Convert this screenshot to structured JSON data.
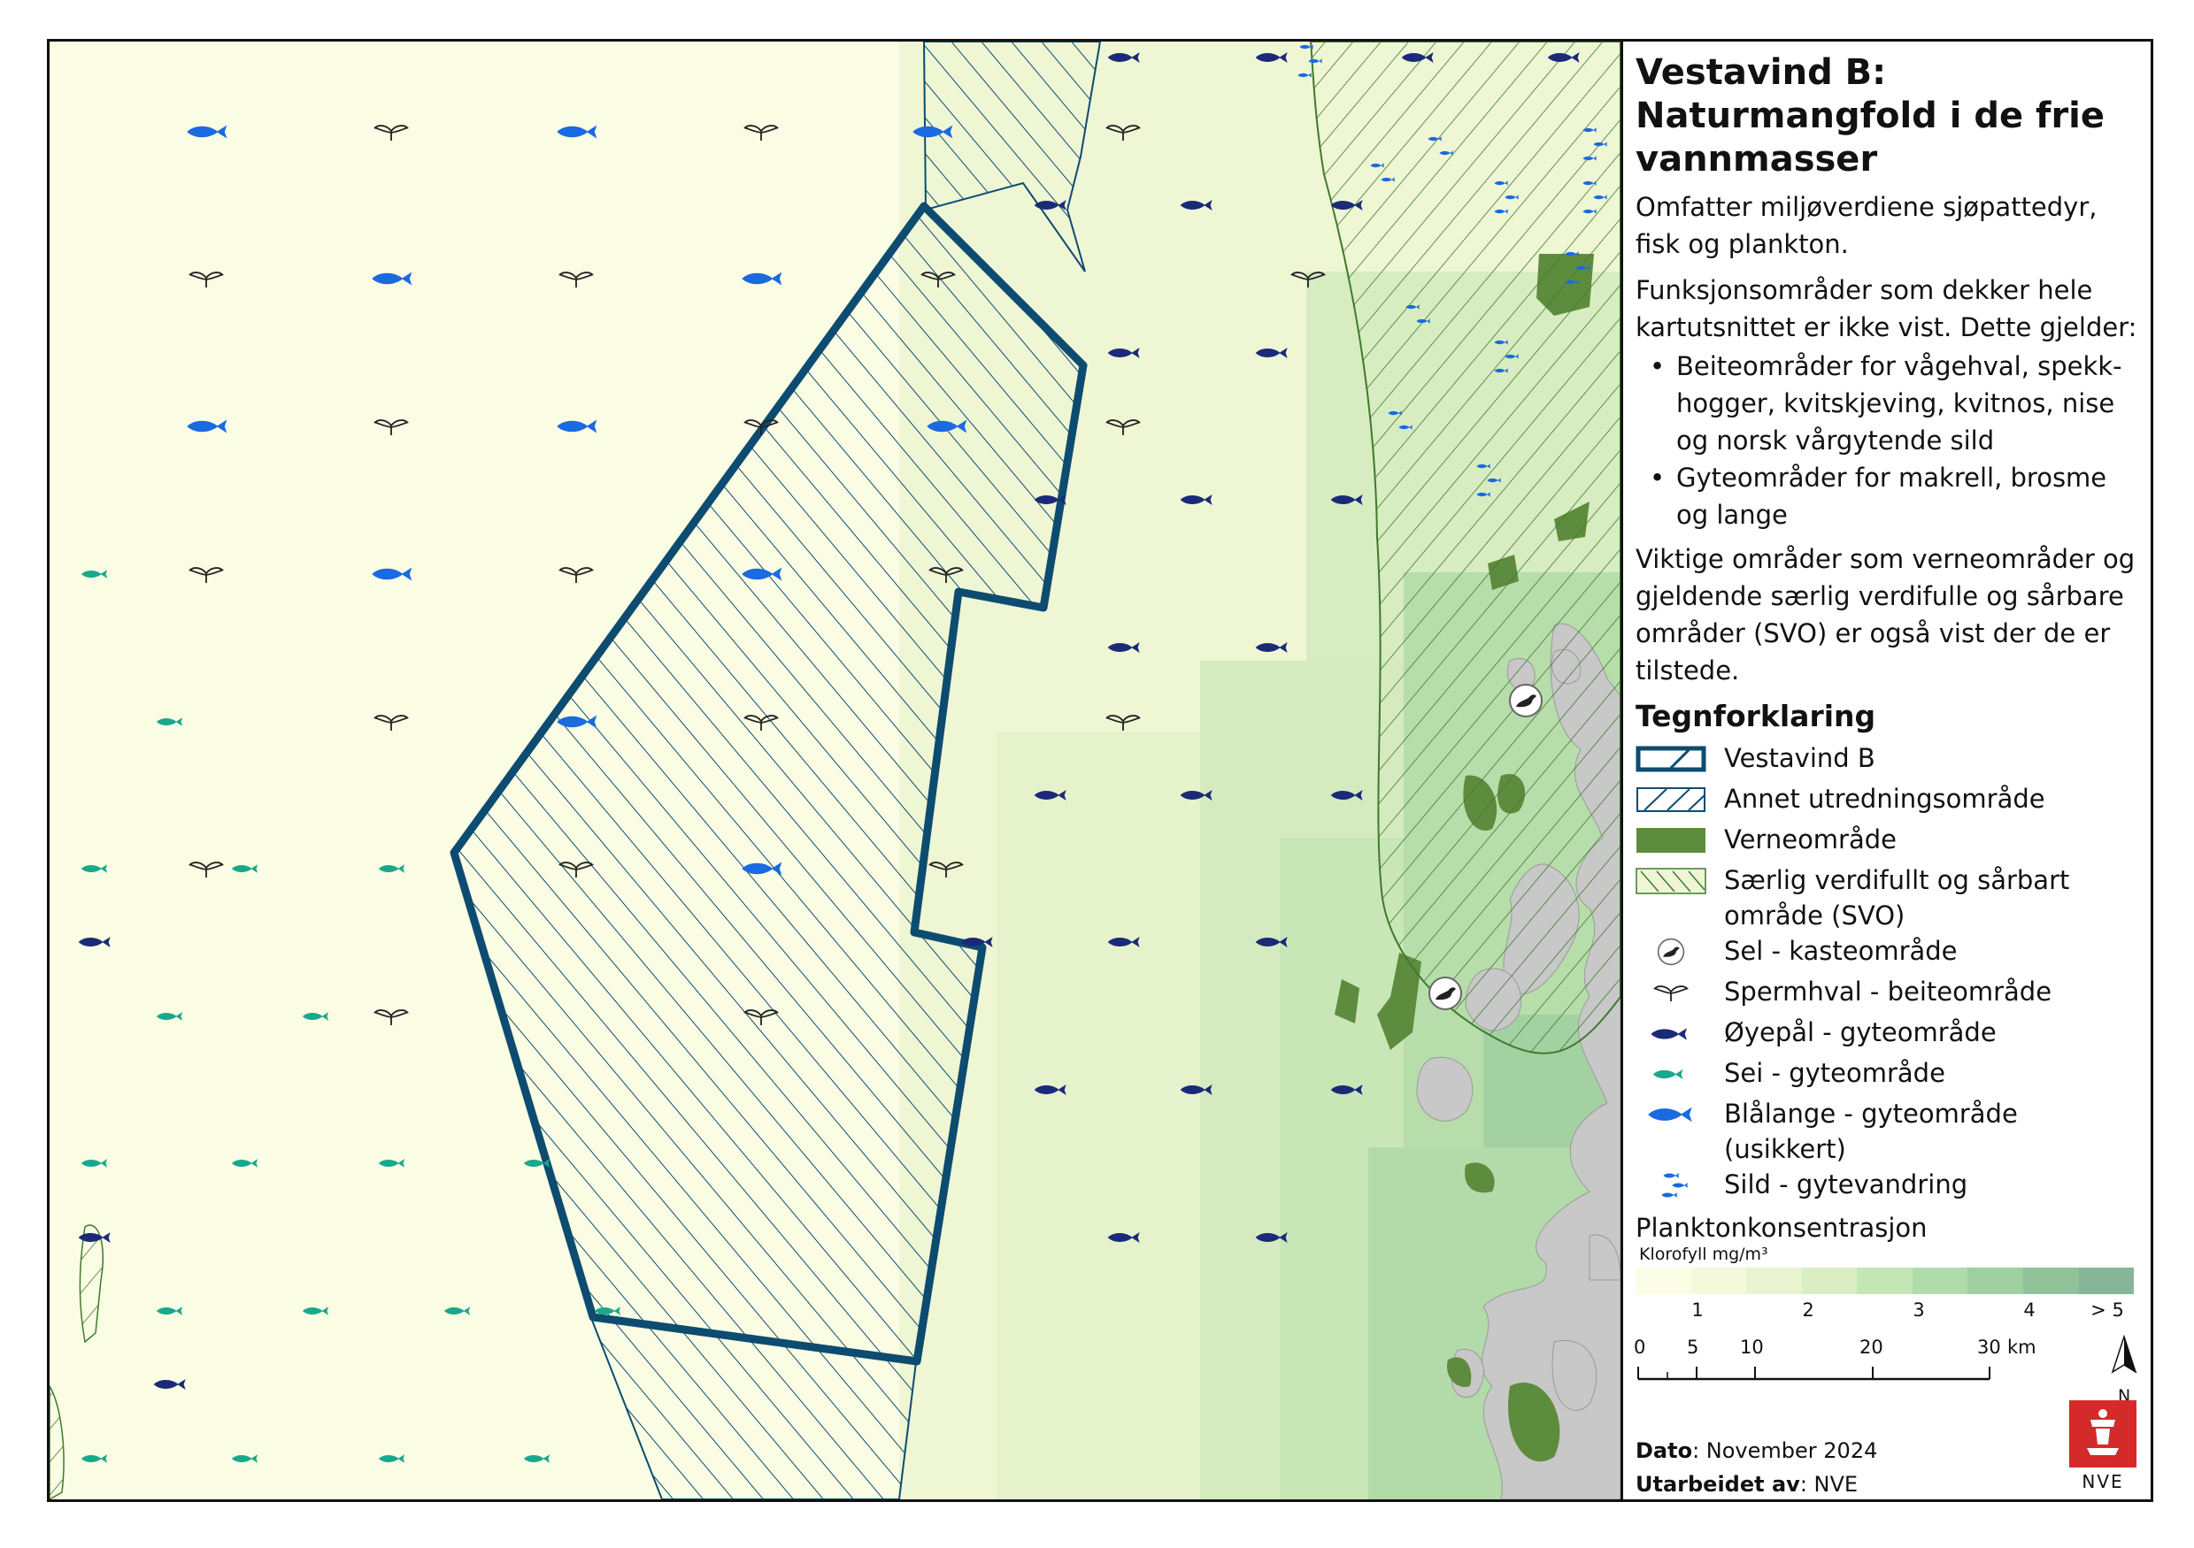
{
  "title": "Vestavind B: Naturmangfold i de frie vannmasser",
  "intro": "Omfatter miljøverdiene sjøpattedyr, fisk og plankton.",
  "funksjon_intro": "Funksjonsområder som dekker hele kartutsnittet er ikke vist. Dette gjelder:",
  "funksjon_items": [
    "Beiteområder for vågehval, spekk-hogger, kvitskjeving, kvitnos, nise og norsk vårgytende sild",
    "Gyteområder for makrell, brosme og lange"
  ],
  "viktige": "Viktige områder som verneområder og gjeldende særlig verdifulle og sårbare områder (SVO) er også vist der de er tilstede.",
  "legend_title": "Tegnforklaring",
  "legend": [
    {
      "label": "Vestavind B",
      "icon": "vestavind-b-swatch"
    },
    {
      "label": "Annet utredningsområde",
      "icon": "hatched-swatch"
    },
    {
      "label": "Verneområde",
      "icon": "green-swatch"
    },
    {
      "label": "Særlig verdifullt og sårbart område (SVO)",
      "icon": "svo-swatch"
    },
    {
      "label": "Sel - kasteområde",
      "icon": "seal-icon"
    },
    {
      "label": "Spermhval - beiteområde",
      "icon": "whale-tail-icon"
    },
    {
      "label": "Øyepål - gyteområde",
      "icon": "fish-navy-icon"
    },
    {
      "label": "Sei - gyteområde",
      "icon": "fish-teal-icon"
    },
    {
      "label": "Blålange - gyteområde (usikkert)",
      "icon": "fish-blue-icon"
    },
    {
      "label": "Sild - gytevandring",
      "icon": "herring-school-icon"
    }
  ],
  "plankton": {
    "title": "Planktonkonsentrasjon",
    "unit": "Klorofyll mg/m³",
    "ticks": [
      "1",
      "2",
      "3",
      "4",
      "> 5"
    ],
    "colors": [
      "#fbfde6",
      "#f4f9dc",
      "#e8f3cf",
      "#d9eec3",
      "#c4e5b4",
      "#b0dbaa",
      "#a0cfa0",
      "#92c29a",
      "#87b597"
    ]
  },
  "scalebar": {
    "ticks": [
      "0",
      "5",
      "10",
      "20",
      "30"
    ],
    "unit": "km",
    "north": "N"
  },
  "dato_label": "Dato",
  "dato_value": ": November 2024",
  "utarbeidet_label": "Utarbeidet av",
  "utarbeidet_value": ": NVE",
  "logo_text": "NVE",
  "colors": {
    "outline": "#0d4c70",
    "verne": "#5e8c3e",
    "sea_light": "#fafde3",
    "sea_mid": "#eef6d4",
    "navy_fish": "#1a2a78",
    "teal_fish": "#1aa88c",
    "blue_fish": "#1a6ae0",
    "logo_red": "#d42a2a"
  }
}
